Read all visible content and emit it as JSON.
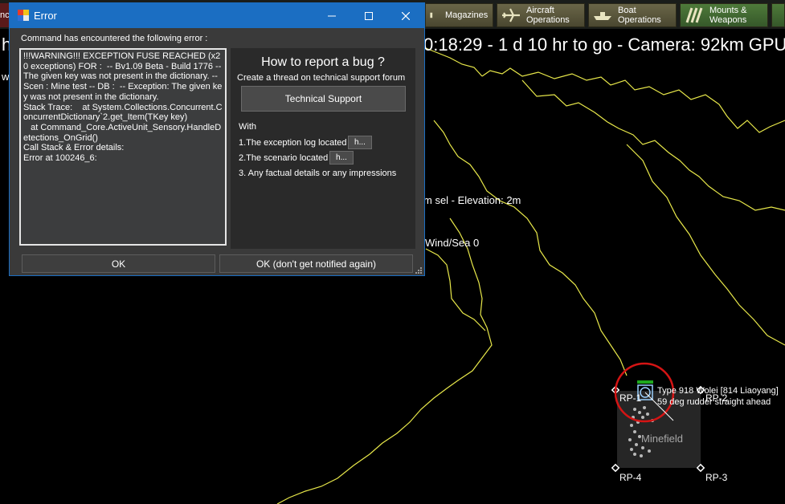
{
  "toolbar": {
    "left_fragment": "nc",
    "buttons": [
      {
        "label": "Magazines",
        "icon": "magazine-icon"
      },
      {
        "label": "Aircraft\nOperations",
        "icon": "aircraft-icon"
      },
      {
        "label": "Boat\nOperations",
        "icon": "boat-icon"
      },
      {
        "label": "Mounts &\nWeapons",
        "icon": "weapons-icon"
      }
    ]
  },
  "map": {
    "status_left": "h",
    "status_right": "0:18:29 - 1 d 10 hr to go - Camera: 92km GPU:",
    "w_left": "w",
    "elevation": "m sel - Elevation: 2m",
    "wind": "Wind/Sea 0",
    "reference_points": [
      "RP-1",
      "RP-2",
      "RP-3",
      "RP-4"
    ],
    "unit_line1": "Type 918 Wolei [814 Liaoyang]",
    "unit_line2": "59 deg   rudder straight ahead",
    "minefield": "Minefield",
    "colors": {
      "coastline": "#e8e84a",
      "selection_ring": "#d41414"
    }
  },
  "dialog": {
    "title": "Error",
    "intro": "Command has encountered the following error :",
    "log": "!!!WARNING!!! EXCEPTION FUSE REACHED (x20 exceptions) FOR :  -- Bv1.09 Beta - Build 1776 -- The given key was not present in the dictionary. -- Scen : Mine test -- DB :  -- Exception: The given key was not present in the dictionary.\nStack Trace:    at System.Collections.Concurrent.ConcurrentDictionary`2.get_Item(TKey key)\n   at Command_Core.ActiveUnit_Sensory.HandleDetections_OnGrid()\nCall Stack & Error details:\nError at 100246_6:",
    "bug": {
      "heading": "How to report a bug ?",
      "sub": "Create a thread on technical support forum",
      "tech_button": "Technical Support",
      "with": "With",
      "line1": "1.The exception log located",
      "line2": "2.The scenario located",
      "line3": "3. Any factual details or any impressions",
      "small_button": "h..."
    },
    "ok": "OK",
    "ok_dont_notify": "OK (don't get notified again)"
  }
}
